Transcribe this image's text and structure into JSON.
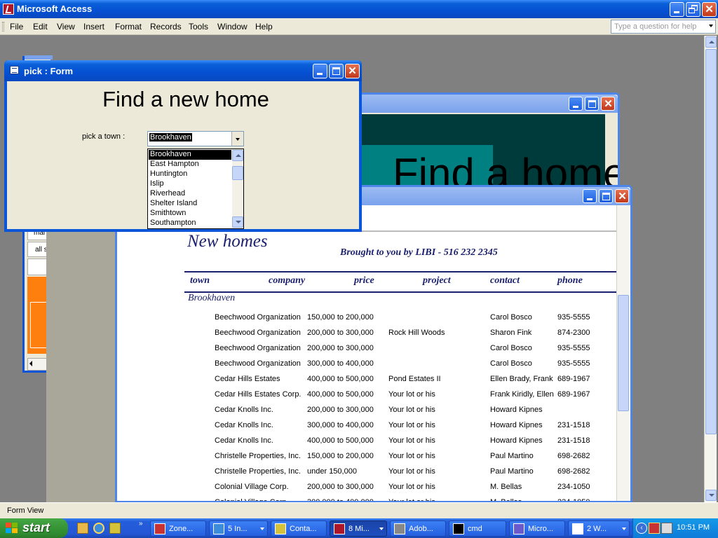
{
  "app": {
    "title": "Microsoft Access",
    "menu": [
      "File",
      "Edit",
      "View",
      "Insert",
      "Format",
      "Records",
      "Tools",
      "Window",
      "Help"
    ],
    "ask_placeholder": "Type a question for help",
    "status": "Form View"
  },
  "db_window": {
    "tabs": [
      "mai",
      "all s"
    ]
  },
  "options_window": {
    "big_text": "Find a home options"
  },
  "pick_form": {
    "title": "pick : Form",
    "heading": "Find a new home",
    "town_label": "pick a town :",
    "selected_town": "Brookhaven",
    "towns": [
      "Brookhaven",
      "East Hampton",
      "Huntington",
      "Islip",
      "Riverhead",
      "Shelter Island",
      "Smithtown",
      "Southampton"
    ]
  },
  "report": {
    "heading": "New homes",
    "subtitle": "Brought to you by LIBI - 516 232 2345",
    "columns": [
      "town",
      "company",
      "price",
      "project",
      "contact",
      "phone"
    ],
    "group": "Brookhaven",
    "rows": [
      {
        "company": "Beechwood Organization",
        "price": "150,000 to 200,000",
        "project": "",
        "contact": "Carol Bosco",
        "phone": "935-5555"
      },
      {
        "company": "Beechwood Organization",
        "price": "200,000 to 300,000",
        "project": "Rock Hill Woods",
        "contact": "Sharon Fink",
        "phone": "874-2300"
      },
      {
        "company": "Beechwood Organization",
        "price": "200,000 to 300,000",
        "project": "",
        "contact": "Carol Bosco",
        "phone": "935-5555"
      },
      {
        "company": "Beechwood Organization",
        "price": "300,000 to 400,000",
        "project": "",
        "contact": "Carol Bosco",
        "phone": "935-5555"
      },
      {
        "company": "Cedar Hills Estates",
        "price": "400,000 to 500,000",
        "project": "Pond Estates II",
        "contact": "Ellen Brady, Frank",
        "phone": "689-1967"
      },
      {
        "company": "Cedar Hills Estates Corp.",
        "price": "400,000 to 500,000",
        "project": "Your lot or his",
        "contact": "Frank Kiridly, Ellen",
        "phone": "689-1967"
      },
      {
        "company": "Cedar Knolls Inc.",
        "price": "200,000 to 300,000",
        "project": "Your lot or his",
        "contact": "Howard Kipnes",
        "phone": ""
      },
      {
        "company": "Cedar Knolls Inc.",
        "price": "300,000 to 400,000",
        "project": "Your lot or his",
        "contact": "Howard Kipnes",
        "phone": "231-1518"
      },
      {
        "company": "Cedar Knolls Inc.",
        "price": "400,000 to 500,000",
        "project": "Your lot or his",
        "contact": "Howard Kipnes",
        "phone": "231-1518"
      },
      {
        "company": "Christelle Properties, Inc.",
        "price": "150,000 to 200,000",
        "project": "Your lot or his",
        "contact": "Paul Martino",
        "phone": "698-2682"
      },
      {
        "company": "Christelle Properties, Inc.",
        "price": "under 150,000",
        "project": "Your lot or his",
        "contact": "Paul Martino",
        "phone": "698-2682"
      },
      {
        "company": "Colonial Village Corp.",
        "price": "200,000 to 300,000",
        "project": "Your lot or his",
        "contact": "M. Bellas",
        "phone": "234-1050"
      },
      {
        "company": "Colonial Village Corp.",
        "price": "300,000 to 400,000",
        "project": "Your lot or his",
        "contact": "M. Bellas",
        "phone": "234-1050"
      }
    ]
  },
  "taskbar": {
    "start": "start",
    "tasks": [
      {
        "label": "Zone...",
        "icon": "zonealarm-icon",
        "color": "#c83232",
        "dropdown": false,
        "active": false
      },
      {
        "label": "5 In...",
        "icon": "internet-explorer-icon",
        "color": "#3c8cdc",
        "dropdown": true,
        "active": false
      },
      {
        "label": "Conta...",
        "icon": "contacts-icon",
        "color": "#d4c23a",
        "dropdown": false,
        "active": false
      },
      {
        "label": "8 Mi...",
        "icon": "access-icon",
        "color": "#b0162a",
        "dropdown": true,
        "active": true
      },
      {
        "label": "Adob...",
        "icon": "adobe-icon",
        "color": "#888888",
        "dropdown": false,
        "active": false
      },
      {
        "label": "cmd",
        "icon": "cmd-icon",
        "color": "#000000",
        "dropdown": false,
        "active": false
      },
      {
        "label": "Micro...",
        "icon": "microsoft-icon",
        "color": "#6a5acd",
        "dropdown": false,
        "active": false
      },
      {
        "label": "2 W...",
        "icon": "ftp-icon",
        "color": "#ffffff",
        "dropdown": true,
        "active": false
      }
    ],
    "clock": "10:51 PM"
  }
}
